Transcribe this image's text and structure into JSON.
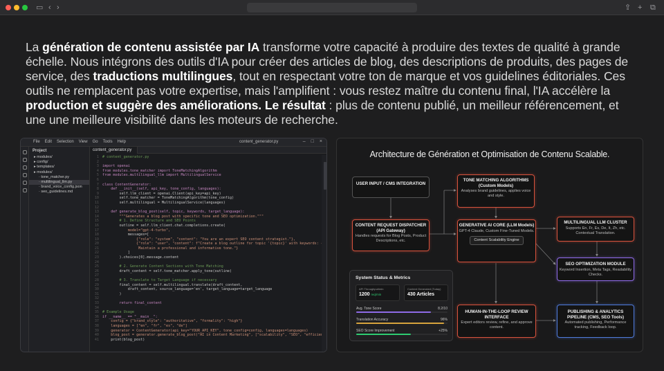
{
  "paragraph": [
    {
      "t": "La ",
      "b": false
    },
    {
      "t": "génération de contenu assistée par IA",
      "b": true
    },
    {
      "t": " transforme votre capacité à produire des textes de qualité à grande échelle. Nous intégrons des outils d'IA pour créer des articles de blog, des descriptions de produits, des pages de service, des ",
      "b": false
    },
    {
      "t": "traductions multilingues",
      "b": true
    },
    {
      "t": ", tout en respectant votre ton de marque et vos guidelines éditoriales. Ces outils ne remplacent pas votre expertise, mais l'amplifient : vous restez maître du contenu final, l'IA accélère la ",
      "b": false
    },
    {
      "t": "production et suggère des améliorations. Le résultat",
      "b": true
    },
    {
      "t": " : plus de contenu publié, un meilleur référencement, et une une meilleure visibilité dans les moteurs de recherche.",
      "b": false
    }
  ],
  "ide": {
    "menu": [
      "File",
      "Edit",
      "Selection",
      "View",
      "Go",
      "Tools",
      "Help"
    ],
    "window_title": "content_generator.py",
    "explorer_title": "Project",
    "files": [
      {
        "name": "modules/",
        "indent": 1
      },
      {
        "name": "config/",
        "indent": 1
      },
      {
        "name": "templates/",
        "indent": 1
      },
      {
        "name": "modules/",
        "indent": 1
      },
      {
        "name": "tone_matcher.py",
        "indent": 2
      },
      {
        "name": "multilingual_llm.py",
        "indent": 2,
        "selected": true
      },
      {
        "name": "brand_voice_config.json",
        "indent": 2
      },
      {
        "name": "seo_guidelines.md",
        "indent": 2
      }
    ],
    "tab": "content_generator.py",
    "code": [
      "# content_generator.py",
      "",
      "import openai",
      "from modules.tone_matcher import ToneMatchingAlgorithm",
      "from modules.multilingual_llm import MultilingualService",
      "",
      "class ContentGenerator:",
      "    def __init__(self, api_key, tone_config, languages):",
      "        self.llm_client = openai.Client(api_key=api_key)",
      "        self.tone_matcher = ToneMatchingAlgorithm(tone_config)",
      "        self.multilingual = MultilingualService(languages)",
      "",
      "    def generate_blog_post(self, topic, keywords, target_language):",
      "        \"\"\"Generates a blog post with specific tone and SEO optimization.\"\"\"",
      "        # 1. Define Structure and SEO Points",
      "        outline = self.llm_client.chat.completions.create(",
      "            model=\"gpt-4-turbo\",",
      "            messages=[",
      "                {\"role\": \"system\", \"content\": \"You are an expert SEO content strategist.\"},",
      "                {\"role\": \"user\", \"content\": f\"Create a blog outline for topic '{topic}' with keywords: {keywords}.",
      "                 Maintain a professional and informative tone.\"}",
      "            ]",
      "        ).choices[0].message.content",
      "",
      "        # 2. Generate Content Sections with Tone Matching",
      "        draft_content = self.tone_matcher.apply_tone(outline)",
      "",
      "        # 3. Translate to Target Language if necessary",
      "        final_content = self.multilingual.translate(draft_content,",
      "            draft_content, source_language='en', target_language=target_language",
      "        )",
      "",
      "        return final_content",
      "",
      "# Example Usage",
      "if __name__ == \"__main__\":",
      "    config = {\"brand_style\": \"authoritative\", \"formality\": \"high\"}",
      "    languages = [\"en\", \"fr\", \"es\", \"de\"]",
      "    generator = ContentGenerator(api_key=\"YOUR_API_KEY\", tone_config=config, languages=languages)",
      "    blog_post = generator.generate_blog_post(\"AI in Content Marketing\", [\"scalability\", \"SEO\", \"efficiency\"], \"fr\")",
      "    print(blog_post)"
    ]
  },
  "diagram": {
    "title": "Architecture de Génération et Optimisation de Contenu Scalable.",
    "boxes": {
      "user_input": {
        "title": "USER INPUT / CMS INTEGRATION",
        "body": ""
      },
      "tone": {
        "title": "TONE MATCHING ALGORITHMS (Custom Models)",
        "body": "Analyses brand guidelines, applies voice and style."
      },
      "dispatcher": {
        "title": "CONTENT REQUEST DISPATCHER (API Gateway)",
        "body": "Handles requests for Blog Posts, Product Descriptions, etc."
      },
      "core": {
        "title": "GENERATIVE AI CORE (LLM Models)",
        "body": "GPT-4 Claude, Custom Fine-Tuned Models.",
        "inner": "Content Scalability Engine"
      },
      "multilingual": {
        "title": "MULTILINGUAL LLM CLUSTER",
        "body": "Supports En, Fr, Es, De, It, Zh, etc. Contextual Translation."
      },
      "seo": {
        "title": "SEO OPTIMIZATION MODULE",
        "body": "Keyword Insertion, Meta Tags, Readability Checks."
      },
      "human": {
        "title": "HUMAN-IN-THE-LOOP REVIEW INTERFACE",
        "body": "Expert editors review, refine, and approve content."
      },
      "publishing": {
        "title": "PUBLISHING & ANALYTICS PIPELINE (CMS, SEO Tools)",
        "body": "Automated publishing, Performance tracking, Feedback loop."
      }
    },
    "stats": {
      "title": "System Status & Metrics",
      "cards": [
        {
          "label": "API Throughput/min",
          "value": "1200",
          "sub": "req/min",
          "color": "#2ecc71"
        },
        {
          "label": "Content Generated (Today)",
          "value": "430 Articles",
          "sub": "",
          "color": "#2ecc71"
        }
      ],
      "metrics": [
        {
          "label": "Avg. Tone Score",
          "value": "8.2/10",
          "fill": 0.82,
          "color": "#8f6be8"
        },
        {
          "label": "Translation Accuracy",
          "value": "96%",
          "fill": 0.96,
          "color": "#d8a43d"
        },
        {
          "label": "SEO Score Improvement",
          "value": "+25%",
          "fill": 0.6,
          "color": "#2ecc71"
        }
      ]
    }
  }
}
